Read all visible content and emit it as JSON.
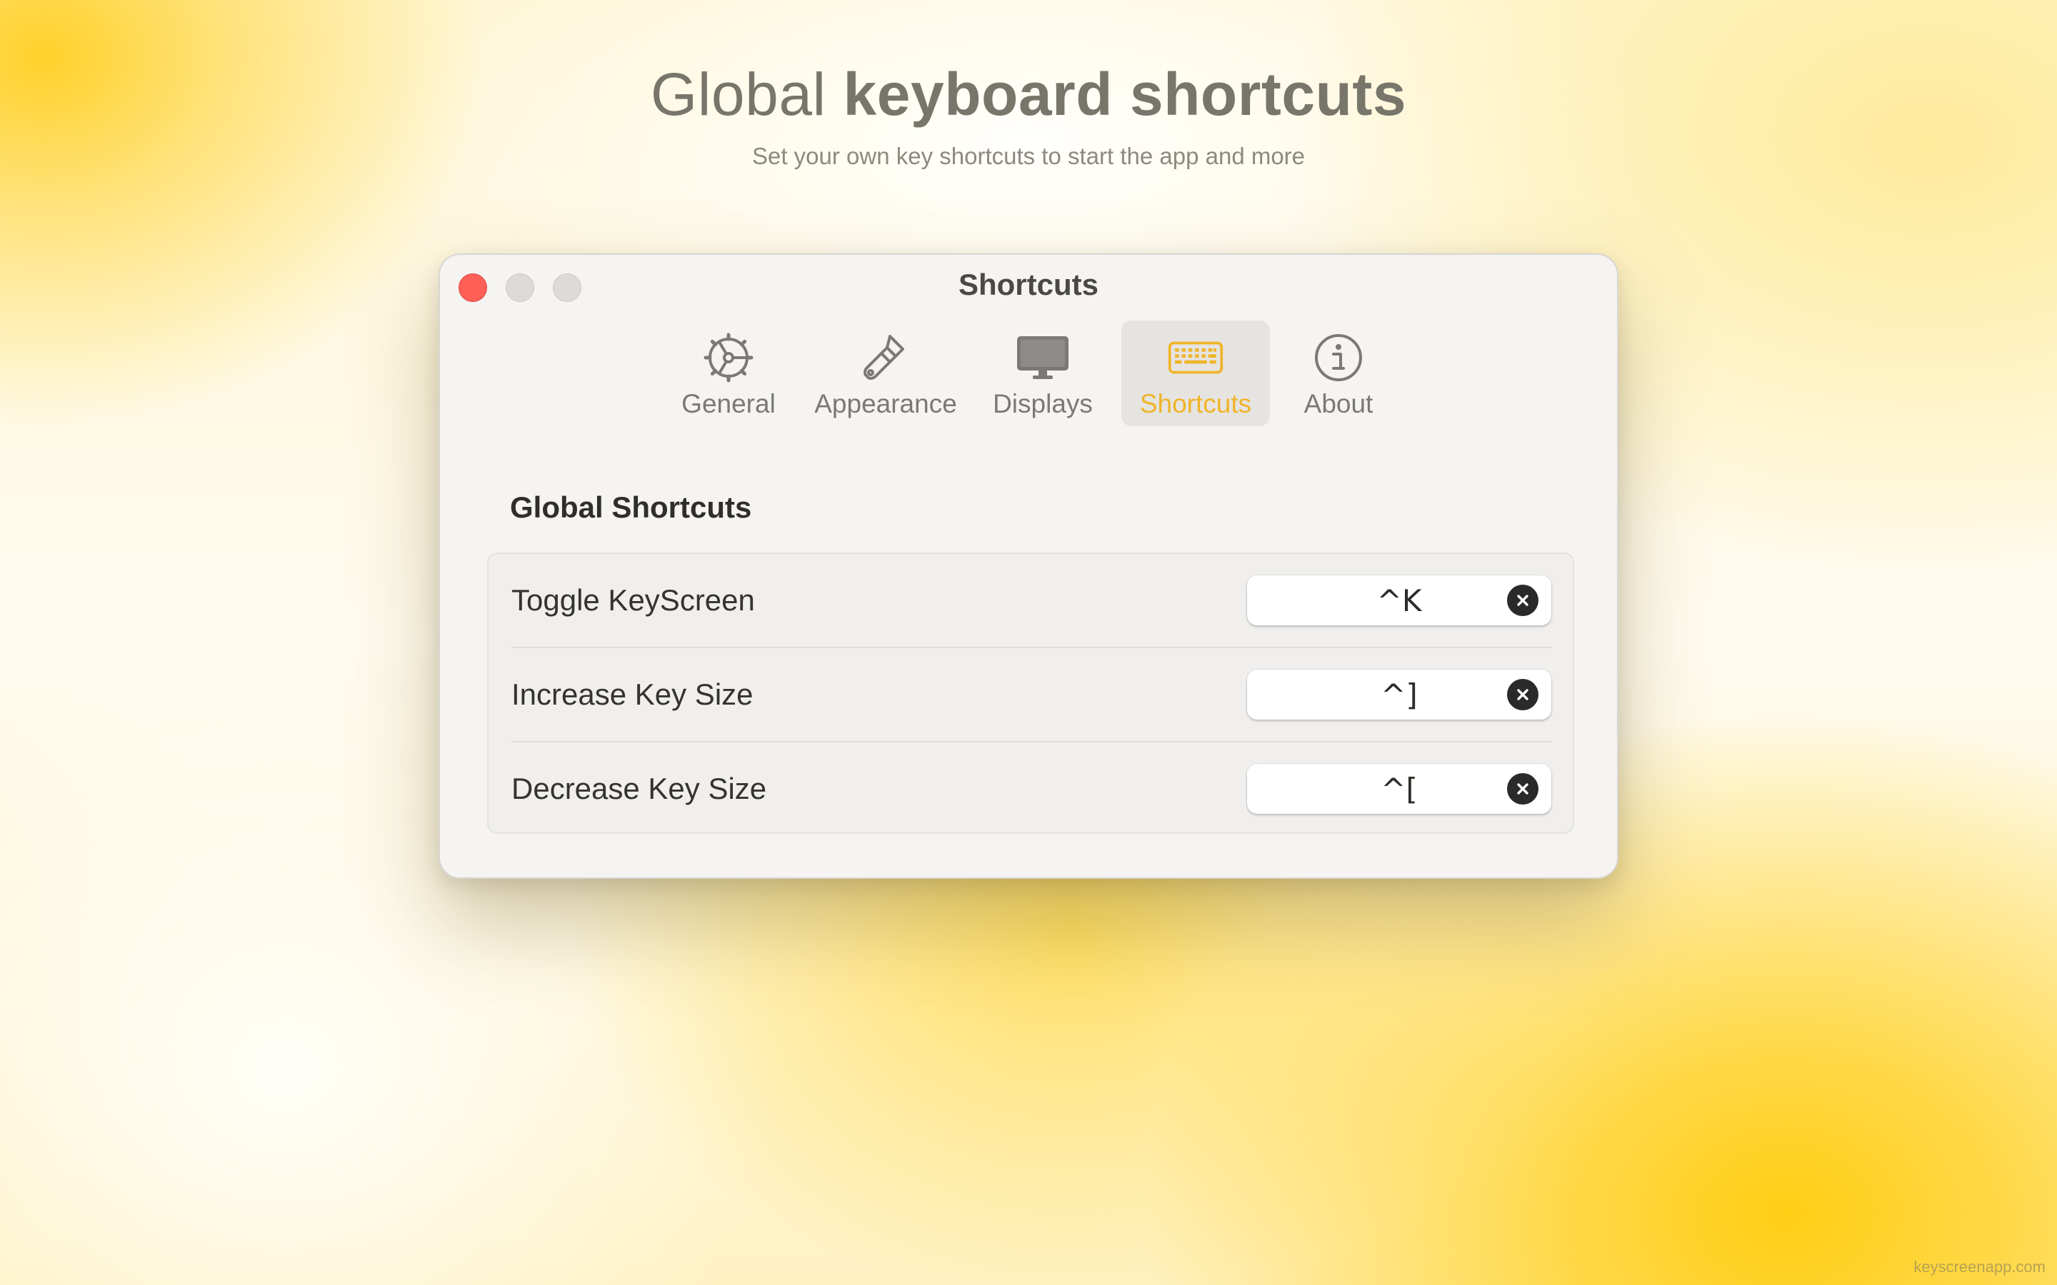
{
  "page": {
    "headline_light": "Global",
    "headline_bold": "keyboard shortcuts",
    "subheadline": "Set your own key shortcuts to start the app and more",
    "watermark": "keyscreenapp.com"
  },
  "window": {
    "title": "Shortcuts",
    "traffic_lights": [
      "close",
      "minimize",
      "zoom"
    ],
    "tabs": [
      {
        "label": "General",
        "icon": "gear-icon",
        "active": false
      },
      {
        "label": "Appearance",
        "icon": "paintbrush-icon",
        "active": false
      },
      {
        "label": "Displays",
        "icon": "display-icon",
        "active": false
      },
      {
        "label": "Shortcuts",
        "icon": "keyboard-icon",
        "active": true
      },
      {
        "label": "About",
        "icon": "info-icon",
        "active": false
      }
    ]
  },
  "section": {
    "title": "Global Shortcuts",
    "rows": [
      {
        "label": "Toggle KeyScreen",
        "shortcut": "^K",
        "clear_icon": "clear-icon"
      },
      {
        "label": "Increase Key Size",
        "shortcut": "^]",
        "clear_icon": "clear-icon"
      },
      {
        "label": "Decrease Key Size",
        "shortcut": "^[",
        "clear_icon": "clear-icon"
      }
    ]
  },
  "colors": {
    "accent": "#f0b429",
    "close_light": "#fe5f57",
    "inactive_light": "#dcdbd9",
    "tab_text": "#7b7975",
    "background_yellow": "#ffd12a"
  }
}
